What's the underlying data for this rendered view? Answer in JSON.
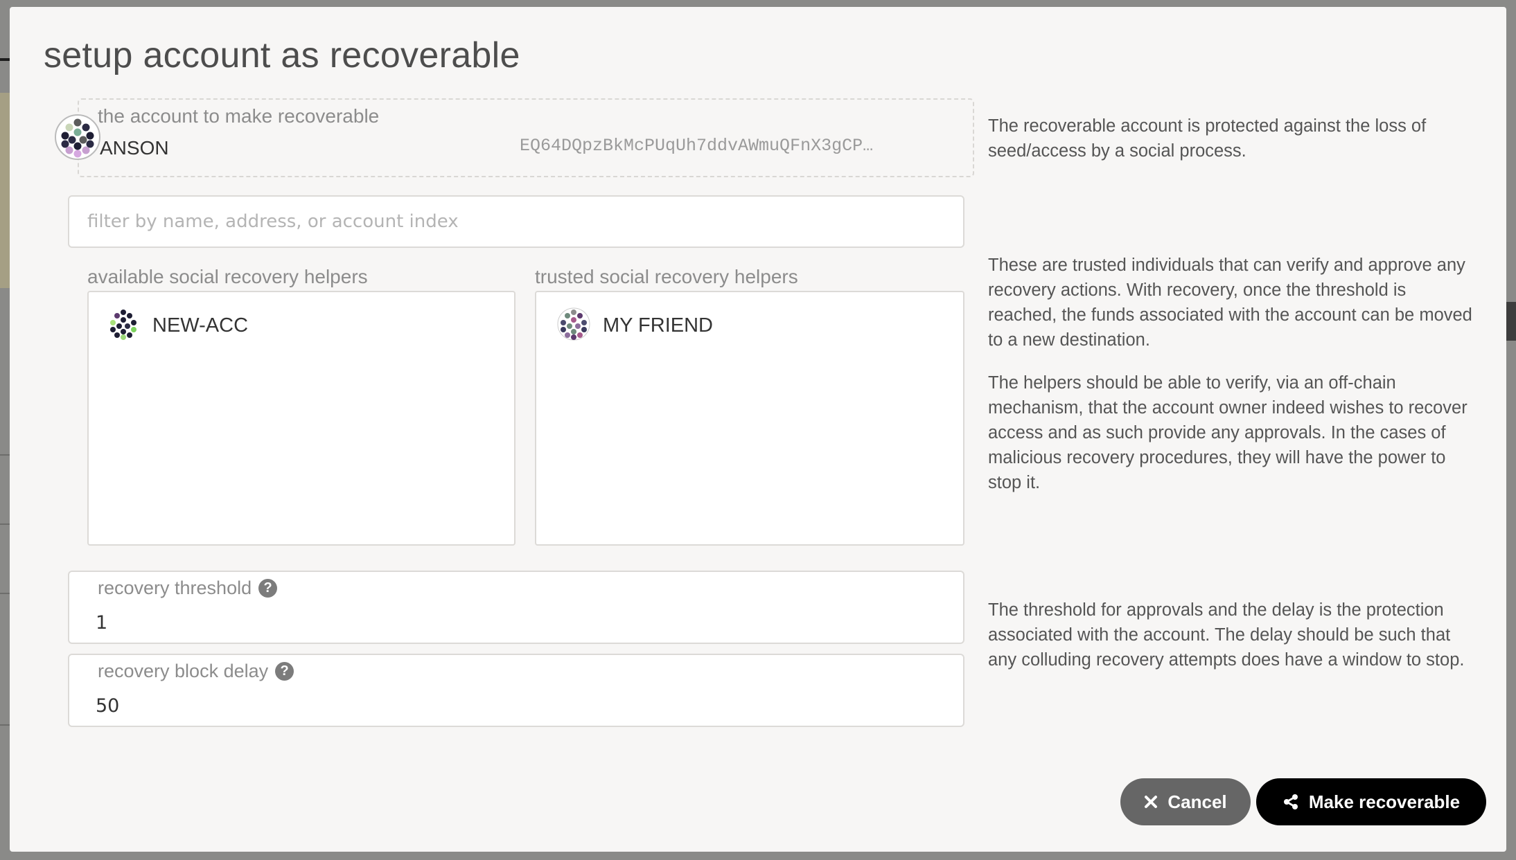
{
  "modal": {
    "title": "setup account as recoverable"
  },
  "account": {
    "label": "the account to make recoverable",
    "name": "ANSON",
    "address": "EQ64DQpzBkMcPUqUh7ddvAWmuQFnX3gCP…",
    "icon": "identicon"
  },
  "filter": {
    "placeholder": "filter by name, address, or account index",
    "value": ""
  },
  "helpers": {
    "available_label": "available social recovery helpers",
    "trusted_label": "trusted social recovery helpers",
    "available": [
      {
        "name": "NEW-ACC",
        "icon": "identicon"
      }
    ],
    "trusted": [
      {
        "name": "MY FRIEND",
        "icon": "identicon"
      }
    ]
  },
  "threshold": {
    "label": "recovery threshold",
    "value": "1",
    "help_icon": "question-circle-icon"
  },
  "delay": {
    "label": "recovery block delay",
    "value": "50",
    "help_icon": "question-circle-icon"
  },
  "help": {
    "p1": "The recoverable account is protected against the loss of seed/access by a social process.",
    "p2": "These are trusted individuals that can verify and approve any recovery actions. With recovery, once the threshold is reached, the funds associated with the account can be moved to a new destination.",
    "p3": "The helpers should be able to verify, via an off-chain mechanism, that the account owner indeed wishes to recover access and as such provide any approvals. In the cases of malicious recovery procedures, they will have the power to stop it.",
    "p4": "The threshold for approvals and the delay is the protection associated with the account. The delay should be such that any colluding recovery attempts does have a window to stop."
  },
  "buttons": {
    "cancel": "Cancel",
    "cancel_icon": "close-icon",
    "make": "Make recoverable",
    "make_icon": "share-icon"
  },
  "colors": {
    "modal_bg": "#f7f6f5",
    "overlay": "#7a7a78",
    "cancel_bg": "#666666",
    "primary_bg": "#000000"
  }
}
